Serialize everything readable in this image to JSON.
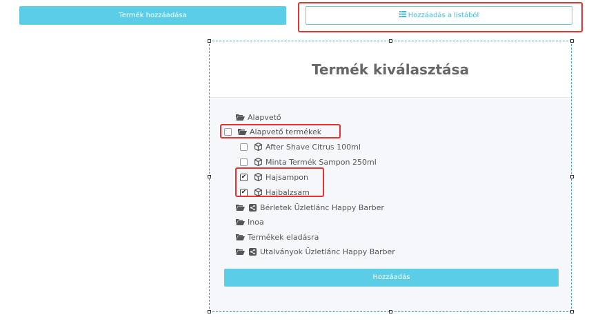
{
  "top_buttons": {
    "add_product": "Termék hozzáadása",
    "add_from_list": "Hozzáadás a listából"
  },
  "modal": {
    "title": "Termék kiválasztása",
    "submit_label": "Hozzáadás"
  },
  "tree": {
    "cat_basic": "Alapvető",
    "cat_basic_products": "Alapvető termékek",
    "item_after_shave": "After Shave Citrus 100ml",
    "item_sample_shampoo": "Minta Termék Sampon 250ml",
    "item_hajsampon": "Hajsampon",
    "item_hajbalzsam": "Hajbalzsam",
    "cat_passes": "Bérletek Üzletlánc Happy Barber",
    "cat_inoa": "Inoa",
    "cat_for_sale": "Termékek eladásra",
    "cat_vouchers": "Utalványok Üzletlánc Happy Barber"
  },
  "checked": {
    "cat_basic_products": false,
    "item_after_shave": false,
    "item_sample_shampoo": false,
    "item_hajsampon": true,
    "item_hajbalzsam": true
  }
}
